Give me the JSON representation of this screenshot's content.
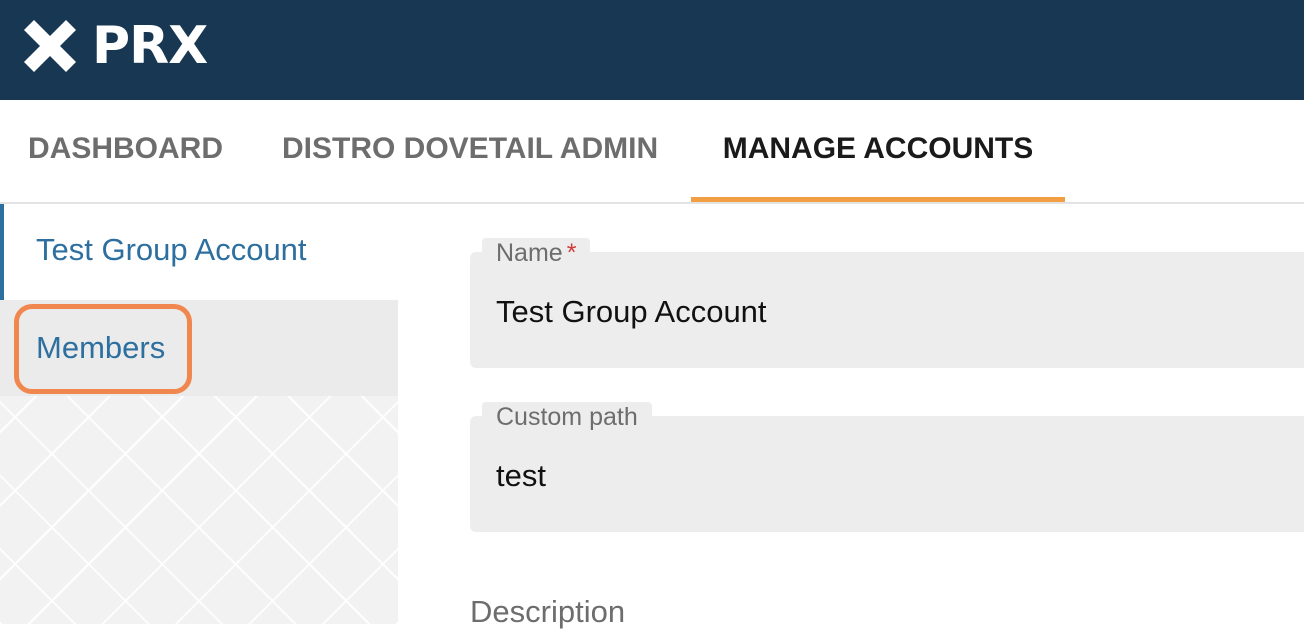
{
  "header": {
    "logo_text": "PRX",
    "logo_icon": "prx-x-mark-icon",
    "background_color": "#173753"
  },
  "nav": {
    "tabs": [
      {
        "label": "DASHBOARD",
        "active": false
      },
      {
        "label": "DISTRO DOVETAIL ADMIN",
        "active": false
      },
      {
        "label": "MANAGE ACCOUNTS",
        "active": true
      }
    ],
    "active_color": "#f29f44"
  },
  "sidebar": {
    "items": [
      {
        "label": "Test Group Account",
        "active": true
      },
      {
        "label": "Members",
        "active": false,
        "highlighted": true
      }
    ],
    "link_color": "#2d6f9f",
    "highlight_color": "#f0874f"
  },
  "form": {
    "name": {
      "label": "Name",
      "required_marker": "*",
      "value": "Test Group Account"
    },
    "custom_path": {
      "label": "Custom path",
      "value": "test"
    },
    "description": {
      "label": "Description"
    }
  }
}
